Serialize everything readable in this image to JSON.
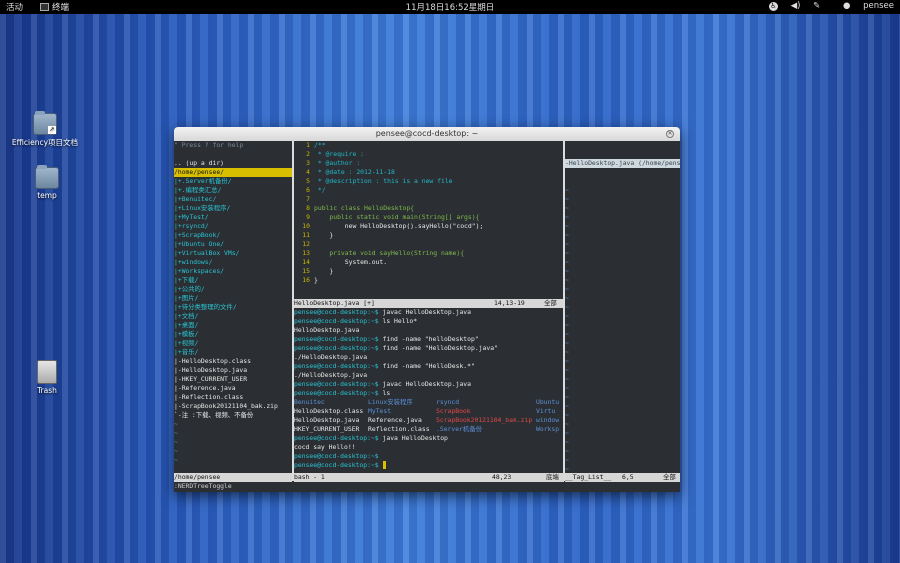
{
  "topbar": {
    "activities": "活动",
    "app_menu": "终端",
    "clock": "11月18日16:52星期日",
    "user": "pensee"
  },
  "desktop_icons": [
    {
      "label": "Efficiency项目文档"
    },
    {
      "label": "temp"
    },
    {
      "label": "Trash"
    }
  ],
  "window": {
    "title": "pensee@cocd-desktop: ~"
  },
  "nerdtree": {
    "lines": [
      "\" Press ? for help",
      "",
      ".. (up a dir)",
      "/home/pensee/",
      "|+.Server机备份/",
      "|+.编程类汇总/",
      "|+Benuitec/",
      "|+Linux安装程序/",
      "|+MyTest/",
      "|+rsyncd/",
      "|+ScrapBook/",
      "|+Ubuntu One/",
      "|+VirtualBox VMs/",
      "|+windows/",
      "|+Workspaces/",
      "|+下载/",
      "|+公共的/",
      "|+图片/",
      "|+待分类整理的文件/",
      "|+文档/",
      "|+桌面/",
      "|+模板/",
      "|+视频/",
      "|+音乐/",
      "|-HelloDesktop.class",
      "|-HelloDesktop.java",
      "|-HKEY_CURRENT_USER",
      "|-Reference.java",
      "|-Reflection.class",
      "|-ScrapBook20121104_bak.zip",
      "`-注 :下载、视频、不备份",
      "~",
      "~",
      "~",
      "~",
      "~"
    ],
    "status": "/home/pensee"
  },
  "editor": {
    "lines": [
      {
        "n": "1",
        "t": "/**",
        "c": "cmt"
      },
      {
        "n": "2",
        "t": " * @require :",
        "c": "cmt"
      },
      {
        "n": "3",
        "t": " * @author :",
        "c": "cmt"
      },
      {
        "n": "4",
        "t": " * @date : 2012-11-18",
        "c": "cmt"
      },
      {
        "n": "5",
        "t": " * @description : this is a new file",
        "c": "cmt"
      },
      {
        "n": "6",
        "t": " */",
        "c": "cmt"
      },
      {
        "n": "7",
        "t": "",
        "c": ""
      },
      {
        "n": "8",
        "t": "public class HelloDesktop{",
        "c": "kw"
      },
      {
        "n": "9",
        "t": "    public static void main(String[] args){",
        "c": "kw"
      },
      {
        "n": "10",
        "t": "        new HelloDesktop().sayHello(\"cocd\");",
        "c": "white"
      },
      {
        "n": "11",
        "t": "    }",
        "c": "white"
      },
      {
        "n": "12",
        "t": "",
        "c": ""
      },
      {
        "n": "13",
        "t": "    private void sayHello(String name){",
        "c": "kw"
      },
      {
        "n": "14",
        "t": "        System.out.",
        "c": "white"
      },
      {
        "n": "15",
        "t": "    }",
        "c": "white"
      },
      {
        "n": "16",
        "t": "}",
        "c": "white"
      }
    ],
    "status_file": "HelloDesktop.java [+]",
    "status_pos": "14,13-19",
    "status_pct": "全部"
  },
  "shell": {
    "lines": [
      {
        "p": "pensee@cocd-desktop:~$ ",
        "t": "javac HelloDesktop.java"
      },
      {
        "p": "pensee@cocd-desktop:~$ ",
        "t": "ls Hello*"
      },
      {
        "p": "",
        "t": "HelloDesktop.java"
      },
      {
        "p": "pensee@cocd-desktop:~$ ",
        "t": "find -name \"helloDesktop\""
      },
      {
        "p": "pensee@cocd-desktop:~$ ",
        "t": "find -name \"HelloDesktop.java\""
      },
      {
        "p": "",
        "t": "./HelloDesktop.java"
      },
      {
        "p": "pensee@cocd-desktop:~$ ",
        "t": "find -name \"HelloDesk.*\""
      },
      {
        "p": "",
        "t": "./HelloDesktop.java"
      },
      {
        "p": "pensee@cocd-desktop:~$ ",
        "t": "javac HelloDesktop.java"
      },
      {
        "p": "pensee@cocd-desktop:~$ ",
        "t": "ls"
      }
    ],
    "ls_rows": [
      [
        "Benuitec",
        "Linux安装程序",
        "rsyncd",
        "Ubuntu"
      ],
      [
        "HelloDesktop.class",
        "MyTest",
        "ScrapBook",
        "Virtu"
      ],
      [
        "HelloDesktop.java",
        "Reference.java",
        "ScrapBook20121104_bak.zip",
        "window"
      ],
      [
        "HKEY_CURRENT_USER",
        "Reflection.class",
        ".Server机备份",
        "Worksp"
      ]
    ],
    "after": [
      {
        "p": "pensee@cocd-desktop:~$ ",
        "t": "java HelloDesktop"
      },
      {
        "p": "",
        "t": "cocd say Hello!!"
      },
      {
        "p": "pensee@cocd-desktop:~$ ",
        "t": ""
      },
      {
        "p": "pensee@cocd-desktop:~$ ",
        "t": ""
      }
    ],
    "status_file": "bash - 1",
    "status_pos": "48,23",
    "status_pct": "底端"
  },
  "taglist": {
    "header": "-HelloDesktop.java (/home/pens",
    "status": "__Tag_List__",
    "status_pos": "6,5",
    "status_pct": "全部"
  },
  "command_line": ":NERDTreeToggle"
}
